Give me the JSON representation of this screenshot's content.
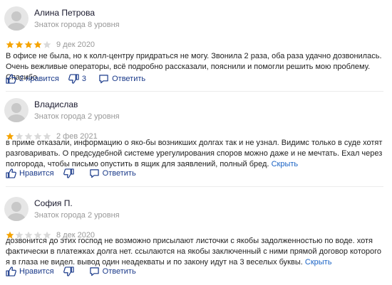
{
  "colors": {
    "star_filled": "#f5a300",
    "star_empty": "#d9d9d9",
    "action": "#1a3a8a",
    "link": "#1a63c5"
  },
  "reviews": [
    {
      "name": "Алина Петрова",
      "level": "Знаток города 8 уровня",
      "rating": 4,
      "date": "9 дек 2020",
      "text": "В офисе не была, но к колл-центру придраться не могу. Звонила 2 раза, оба раза удачно дозвонилась. Очень вежливые операторы, всё подробно рассказали, пояснили и помогли решить мою проблему. Спасибо",
      "hide_label": "",
      "like_label": "2 нравится",
      "dislike_count": "3",
      "reply_label": "Ответить"
    },
    {
      "name": "Владислав",
      "level": "Знаток города 2 уровня",
      "rating": 1,
      "date": "2 фев 2021",
      "text": "в приме отказали, информацию о яко-бы возникших долгах так и не узнал. Видимс только в суде хотят разговаривать. О предсудебной системе урегулирования споров можно даже и не мечтать. Ехал через полгорода, чтобы письмо опустить в ящик для заявлений, полный бред.",
      "hide_label": "Скрыть",
      "like_label": "Нравится",
      "dislike_count": "",
      "reply_label": "Ответить"
    },
    {
      "name": "София П.",
      "level": "Знаток города 2 уровня",
      "rating": 1,
      "date": "8 дек 2020",
      "text": "дозвонится до этих господ не возможно присылают листочки с якобы задолженностью по воде. хотя фактически в платежках долга нет. ссылаются на якобы заключенный с ними прямой договор которого я в глаза не видел. вывод один неадекваты и по закону идут на 3 веселых буквы.",
      "hide_label": "Скрыть",
      "like_label": "Нравится",
      "dislike_count": "",
      "reply_label": "Ответить"
    }
  ]
}
